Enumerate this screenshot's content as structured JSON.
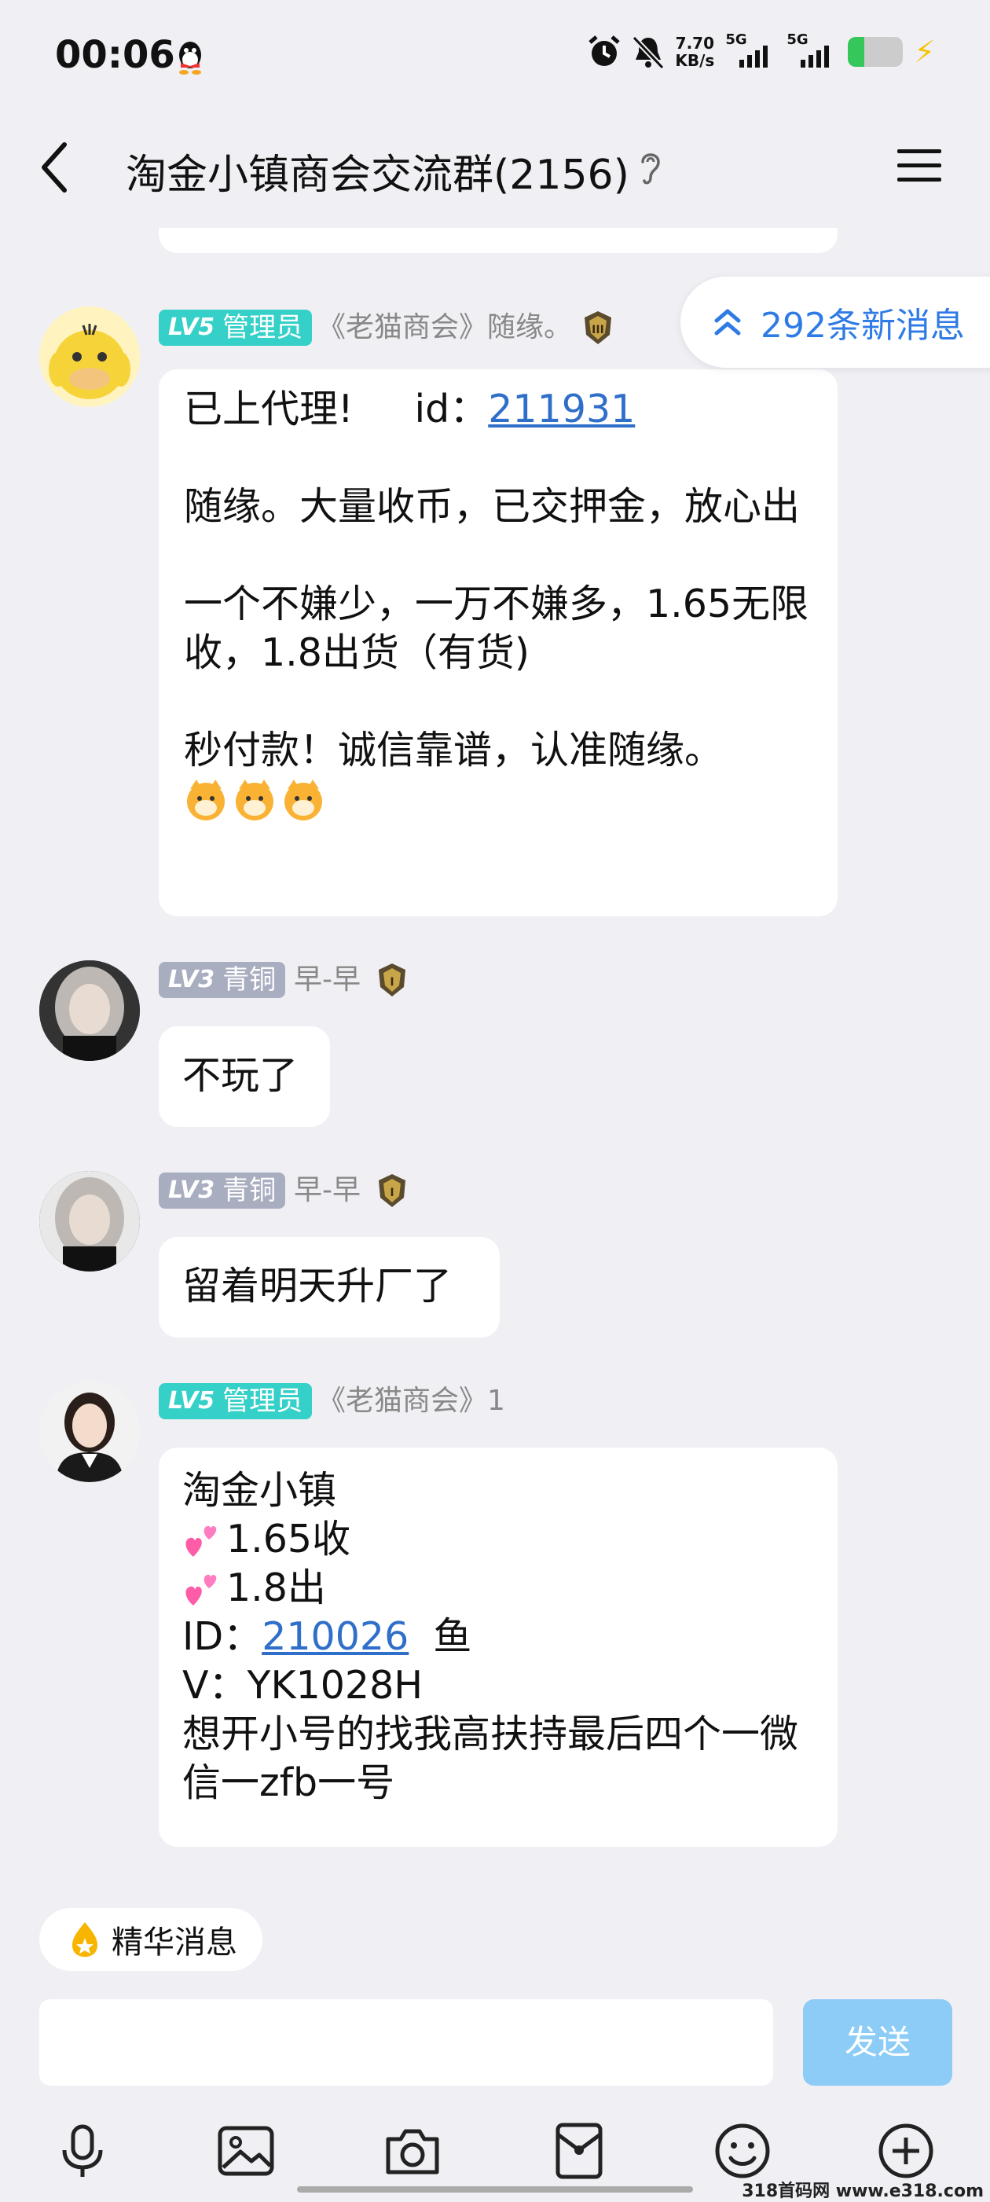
{
  "status_bar": {
    "time": "00:06",
    "net_speed_value": "7.70",
    "net_speed_unit": "KB/s",
    "sim1": "5G",
    "sim2": "5G"
  },
  "header": {
    "title": "淘金小镇商会交流群(2156)"
  },
  "new_messages": {
    "label": "292条新消息"
  },
  "messages": [
    {
      "tag_level": "LV5",
      "tag_role": "管理员",
      "sender": "《老猫商会》随缘。",
      "line1_prefix": "已上代理!     id：",
      "line1_id": "211931",
      "para2": "随缘。大量收币，已交押金，放心出",
      "para3": "一个不嫌少，一万不嫌多，1.65无限收，1.8出货（有货)",
      "para4": "秒付款！诚信靠谱，认准随缘。",
      "emoji_row": "🐱🐱🐱"
    },
    {
      "tag_level": "LV3",
      "tag_role": "青铜",
      "sender": "早-早",
      "text": "不玩了"
    },
    {
      "tag_level": "LV3",
      "tag_role": "青铜",
      "sender": "早-早",
      "text": "留着明天升厂了"
    },
    {
      "tag_level": "LV5",
      "tag_role": "管理员",
      "sender": "《老猫商会》1",
      "line1": "淘金小镇",
      "line2": "1.65收",
      "line3": "1.8出",
      "line4_prefix": "ID：",
      "line4_id": "210026",
      "line4_suffix": "  鱼",
      "line5": "V：YK1028H",
      "line6": "想开小号的找我高扶持最后四个一微信一zfb一号"
    }
  ],
  "essence_button": "精华消息",
  "send_button": "发送",
  "watermark": "318首码网 www.e318.com",
  "colors": {
    "accent": "#2f7be6",
    "admin_tag": "#35d0c8",
    "bronze_tag": "#a8aec0",
    "send_disabled": "#8cccf6",
    "background": "#f0f0f4"
  },
  "icons": [
    "qq-icon",
    "alarm-icon",
    "mute-icon",
    "back-arrow-icon",
    "ear-icon",
    "menu-icon",
    "double-chevron-up-icon",
    "flame-icon",
    "mic-icon",
    "image-icon",
    "camera-icon",
    "red-packet-icon",
    "emoji-icon",
    "plus-icon"
  ]
}
